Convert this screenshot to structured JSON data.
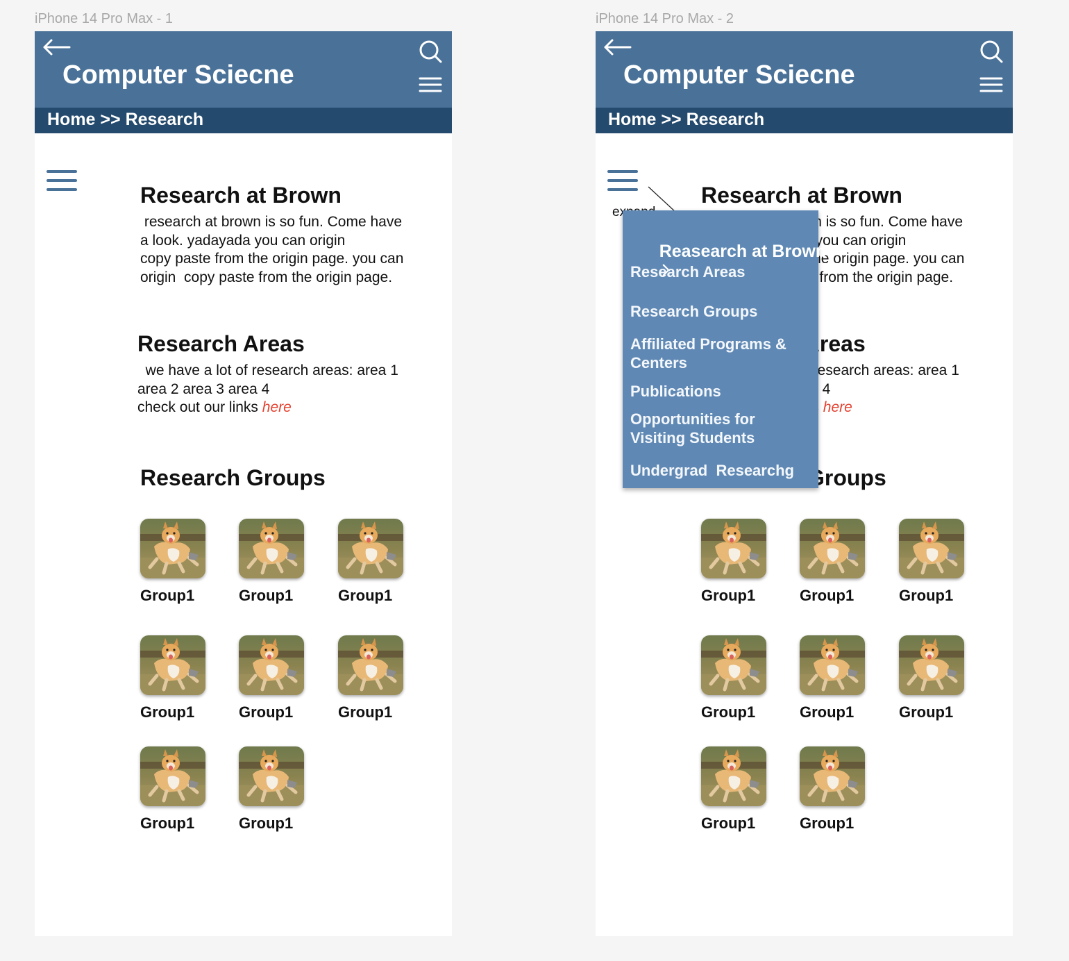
{
  "frames": [
    {
      "label": "iPhone 14 Pro Max - 1",
      "header": {
        "title": "Computer Sciecne"
      },
      "breadcrumb": {
        "home": "Home",
        "separator": ">>",
        "current": "Research"
      },
      "sections": {
        "brown": {
          "heading": "Research at Brown",
          "text": " research at brown is so fun. Come have\na look. yadayada you can origin\ncopy paste from the origin page. you can\norigin  copy paste from the origin page."
        },
        "areas": {
          "heading": "Research Areas",
          "text": "  we have a lot of research areas: area 1\narea 2 area 3 area 4\ncheck out our links ",
          "link": "here"
        },
        "groups": {
          "heading": "Research Groups",
          "items": [
            "Group1",
            "Group1",
            "Group1",
            "Group1",
            "Group1",
            "Group1",
            "Group1",
            "Group1"
          ]
        }
      }
    },
    {
      "label": "iPhone 14 Pro Max - 2",
      "header": {
        "title": "Computer Sciecne"
      },
      "breadcrumb": {
        "home": "Home",
        "separator": ">>",
        "current": "Research"
      },
      "annotation": "expand",
      "menu": {
        "items": [
          "Reasearch at Brown",
          "Research Areas",
          "Research Groups",
          "Affiliated Programs &\nCenters",
          "Publications",
          "Opportunities for\nVisiting Students",
          "Undergrad  Researchg"
        ]
      },
      "sections": {
        "brown": {
          "heading": "Research at Brown",
          "text": " research at brown is so fun. Come have\na look. yadayada you can origin\ncopy paste from the origin page. you can\norigin  copy paste from the origin page."
        },
        "areas": {
          "heading": "Research Areas",
          "text": "  we have a lot of research areas: area 1\narea 2 area 3 area 4\ncheck out our links ",
          "link": "here"
        },
        "groups": {
          "heading": "Research Groups",
          "items": [
            "Group1",
            "Group1",
            "Group1",
            "Group1",
            "Group1",
            "Group1",
            "Group1",
            "Group1"
          ]
        }
      }
    }
  ],
  "colors": {
    "header": "#4a7299",
    "breadcrumb": "#244a6e",
    "menu": "#5f89b4",
    "link": "#e5412f",
    "canvas": "#f5f5f5"
  },
  "icons": [
    "back-arrow-icon",
    "search-icon",
    "hamburger-menu-icon",
    "chevron-right-icon",
    "dog-photo-thumbnail"
  ]
}
